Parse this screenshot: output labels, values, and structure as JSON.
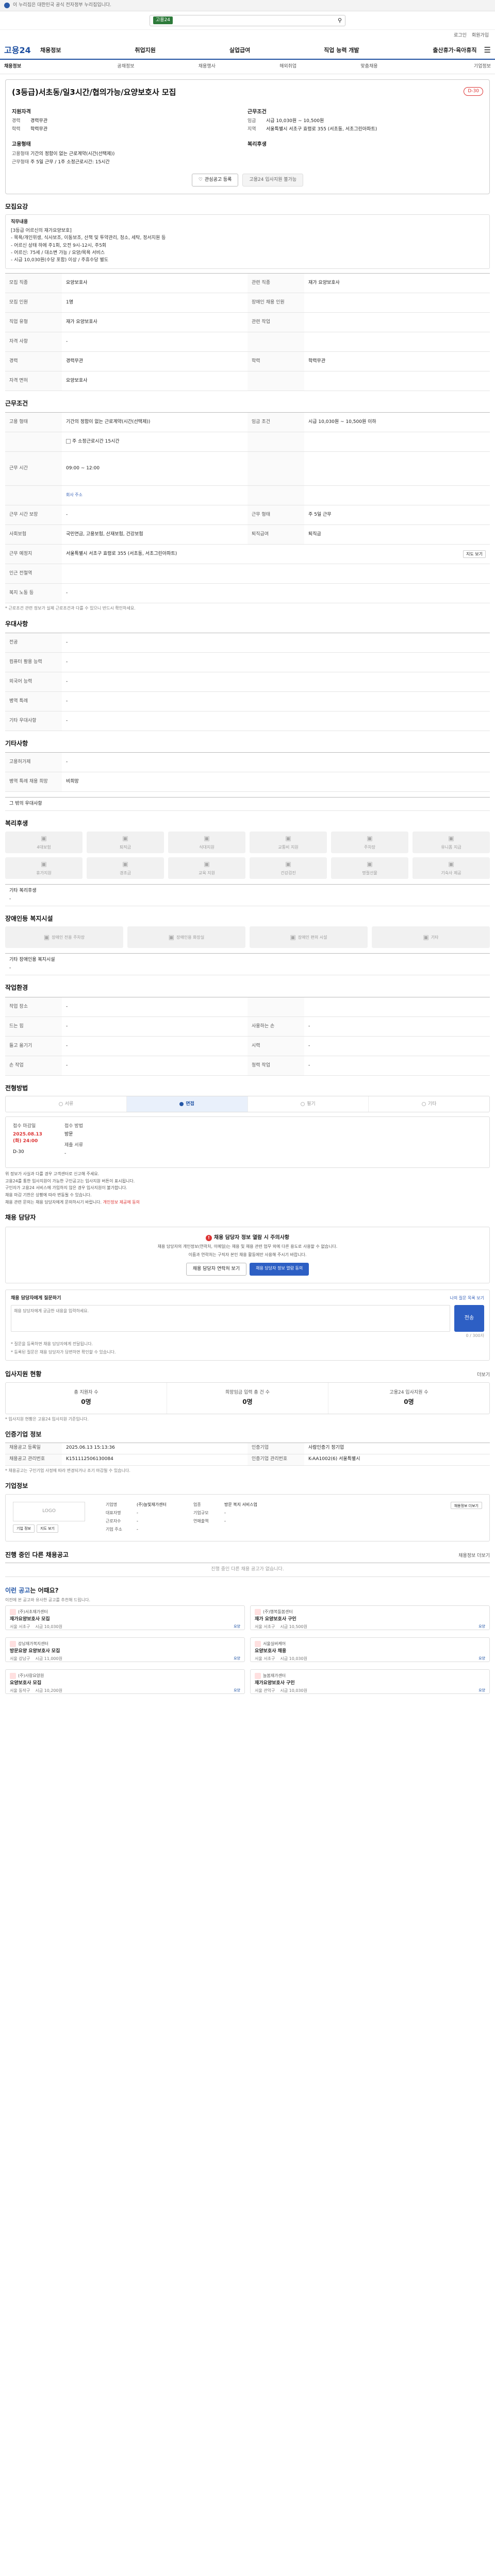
{
  "top_banner": "이 누리집은 대한민국 공식 전자정부 누리집입니다.",
  "search": {
    "tag": "고용24",
    "placeholder": ""
  },
  "util": [
    "로그인",
    "회원가입"
  ],
  "gnb": {
    "logo": "고용24",
    "items": [
      "채용정보",
      "취업지원",
      "실업급여",
      "직업 능력 개발",
      "출산휴가·육아휴직"
    ]
  },
  "subnav": [
    "채용정보",
    "공채정보",
    "채용행사",
    "해외취업",
    "맞춤채용",
    "기업정보"
  ],
  "job": {
    "title": "(3등급)서초동/일3시간/협의가능/요양보호사 모집",
    "dday": "D-30",
    "company_heading": "지원자격",
    "company_rows": [
      {
        "k": "경력",
        "v": "경력무관"
      },
      {
        "k": "학력",
        "v": "학력무관"
      }
    ],
    "cond_heading": "근무조건",
    "cond_rows": [
      {
        "k": "임금",
        "v": "시급 10,030원 ~ 10,500원"
      },
      {
        "k": "지역",
        "v": "서울특별시 서초구 효령로 355 (서초동, 서초그린아파트)"
      }
    ],
    "type_heading": "고용형태",
    "type_rows": [
      {
        "k": "고용형태",
        "v": "기간의 정함이 없는 근로계약(시간(선택제))"
      },
      {
        "k": "근무형태",
        "v": "주 5일 근무 / 1주 소정근로시간: 15시간"
      }
    ],
    "welfare_heading": "복리후생",
    "btn_interest": "관심공고 등록",
    "btn_apply": "고용24 입사지원 불가능"
  },
  "detail": {
    "title": "모집요강",
    "desc_label": "직무내용",
    "desc_lines": [
      "[3등급 어르신의 재가요양보호]",
      "- 목욕/개인위생, 식사보조, 이동보조, 산책 및 투약관리, 청소, 세탁, 정서지원 등",
      "- 어르신 상태 하에 주1회, 오전 9시-12시, 주5회",
      "- 어르신: 75세 / 대소변 가능 / 요양/목욕 서비스",
      "- 시급 10,030원(수당 포함) 이상 / 주휴수당 별도"
    ],
    "rows": [
      {
        "k": "모집 직종",
        "v": "요양보호사",
        "k2": "관련 직종",
        "v2": "재가 요양보호사"
      },
      {
        "k": "모집 인원",
        "v": "1명",
        "k2": "장애인 채용 인원",
        "v2": ""
      },
      {
        "k": "직업 유형",
        "v": "재가 요양보호사",
        "k2": "관련 작업",
        "v2": ""
      },
      {
        "k": "자격 사항",
        "v": "-",
        "k2": "",
        "v2": ""
      },
      {
        "k": "경력",
        "v": "경력무관",
        "k2": "학력",
        "v2": "학력무관"
      },
      {
        "k": "자격 면허",
        "v": "요양보호사",
        "k2": "",
        "v2": ""
      }
    ]
  },
  "condition": {
    "title": "근무조건",
    "rows": [
      {
        "k": "고용 형태",
        "v": "기간의 정함이 없는 근로계약(시간(선택제))",
        "k2": "임금 조건",
        "v2": "시급 10,030원 ~ 10,500원 이하"
      },
      {
        "k": "",
        "v": "주 소정근로시간: 15시간",
        "k2": "",
        "v2": ""
      },
      {
        "k": "근무 시간",
        "v": "09:00 ~ 12:00",
        "k2": "",
        "v2": ""
      },
      {
        "k": "",
        "v": "회사 주소",
        "k2": "",
        "v2": ""
      },
      {
        "k": "근무 시간 보장",
        "v": "-",
        "k2": "근무 형태",
        "v2": "주 5일 근무"
      },
      {
        "k": "사회보험",
        "v": "국민연금, 고용보험, 산재보험, 건강보험",
        "k2": "퇴직급여",
        "v2": "퇴직금"
      },
      {
        "k": "근무 예정지",
        "v": "서울특별시 서초구 효령로 355 (서초동, 서초그린아파트)",
        "k2": "",
        "v2": "지도 보기"
      },
      {
        "k": "인근 전철역",
        "v": "",
        "k2": "",
        "v2": ""
      },
      {
        "k": "복지 노동 등",
        "v": "-",
        "k2": "",
        "v2": ""
      }
    ],
    "time_label": "주 소정근로시간 15시간",
    "notice": "* 근로조건 관련 정보가 실제 근로조건과 다를 수 있으니 반드시 확인하세요."
  },
  "preference": {
    "title": "우대사항",
    "rows": [
      {
        "k": "전공",
        "v": "-"
      },
      {
        "k": "컴퓨터 활용 능력",
        "v": "-"
      },
      {
        "k": "외국어 능력",
        "v": "-"
      },
      {
        "k": "병역 특례",
        "v": "-"
      },
      {
        "k": "기타 우대사항",
        "v": "-"
      }
    ]
  },
  "other": {
    "title": "기타사항",
    "rows": [
      {
        "k": "고용허가제",
        "v": "-"
      },
      {
        "k": "병역 특례 채용 희망",
        "v": "비희망"
      }
    ],
    "link_label": "그 밖의 우대사항"
  },
  "welfare": {
    "title": "복리후생",
    "items": [
      "4대보험",
      "퇴직금",
      "식대지원",
      "교통비 지원",
      "주차장",
      "유니폼 지급",
      "휴가지원",
      "경조금",
      "교육 지원",
      "건강검진",
      "명절선물",
      "기숙사 제공"
    ],
    "etc_label": "기타 복리후생",
    "etc_value": "-"
  },
  "disability": {
    "title": "장애인등 복지시설",
    "items": [
      "장애인 전용 주차장",
      "장애인용 화장실",
      "장애인 편의 시설",
      "기타"
    ],
    "etc_label": "기타 장애인용 복지시설",
    "etc_value": "-"
  },
  "work_env": {
    "title": "작업환경",
    "rows": [
      {
        "k": "작업 장소",
        "v": "-",
        "k2": "",
        "v2": ""
      },
      {
        "k": "드는 힘",
        "v": "-",
        "k2": "사용하는 손",
        "v2": "-"
      },
      {
        "k": "들고 옮기기",
        "v": "-",
        "k2": "시력",
        "v2": "-"
      },
      {
        "k": "손 작업",
        "v": "-",
        "k2": "청력 작업",
        "v2": "-"
      }
    ]
  },
  "process": {
    "title": "전형방법",
    "steps": [
      "서류",
      "면접",
      "필기",
      "기타"
    ],
    "active": 1,
    "col1": {
      "l1": "접수 마감일",
      "v1": "2025.08.13 (화) 24:00",
      "l2": "D-30"
    },
    "col2": {
      "l1": "접수 방법",
      "v1": "방문",
      "l2": "제출 서류",
      "v2": "-"
    },
    "bullets": [
      "위 정보가 사실과 다를 경우 고객센터로 신고해 주세요.",
      "고용24를 통한 입사지원이 가능한 구인공고는 입사지원 버튼이 표시됩니다.",
      "구인자가 고용24 서비스에 가입하지 않은 경우 입사지원이 불가합니다.",
      "채용 마감 기한은 상황에 따라 변동될 수 있습니다.",
      "채용 관련 문의는 채용 담당자에게 문의하시기 바랍니다."
    ],
    "highlight": "개인정보 제공에 동의"
  },
  "contact": {
    "title": "채용 담당자",
    "warn": "채용 담당자 정보 열람 시 주의사항",
    "text1": "채용 담당자의 개인정보(연락처, 이메일)는 채용 및 채용 관련 업무 외에 다른 용도로 사용할 수 없습니다.",
    "text2": "이름과 연락처는 구직자 본인 채용 활동에만 사용해 주시기 바랍니다.",
    "btn1": "채용 담당자 연락처 보기",
    "btn2": "채용 담당자 정보 열람 동의",
    "inquiry_title": "채용 담당자에게 질문하기",
    "inquiry_right": "나의 질문 목록 보기",
    "inquiry_placeholder": "채용 담당자에게 궁금한 내용을 입력하세요.",
    "inquiry_submit": "전송",
    "inquiry_count": "0 / 300자",
    "notes": [
      "* 질문을 등록하면 채용 담당자에게 전달됩니다.",
      "* 등록된 질문은 채용 담당자가 답변하면 확인할 수 있습니다."
    ]
  },
  "status": {
    "title": "입사지원 현황",
    "more": "더보기",
    "items": [
      {
        "l": "총 지원자 수",
        "n": "0명"
      },
      {
        "l": "희망임금 입력 총 건 수",
        "n": "0명"
      },
      {
        "l": "고용24 입사지원 수",
        "n": "0명"
      }
    ],
    "notice": "* 입사지원 현황은 고용24 입사지원 기준입니다."
  },
  "post_info": {
    "title": "인증기업 정보",
    "rows": [
      {
        "k": "채용공고 등록일",
        "v": "2025.06.13 15:13:36",
        "k2": "인증기업",
        "v2": "사람인증기 정기업"
      },
      {
        "k": "채용공고 관리번호",
        "v": "K151112506130084",
        "k2": "인증기업 관리번호",
        "v2": "K-AA1002(6) 서울특별시"
      }
    ],
    "notice": "* 채용공고는 구인기업 사정에 따라 변경되거나 조기 마감될 수 있습니다."
  },
  "company": {
    "title": "기업정보",
    "logo": "LOGO",
    "btns": [
      "기업 정보",
      "지도 보기"
    ],
    "info": [
      {
        "k": "기업명",
        "v": "(주)늘빛재가센터"
      },
      {
        "k": "업종",
        "v": "방문 복지 서비스업"
      },
      {
        "k": "대표자명",
        "v": "-"
      },
      {
        "k": "기업규모",
        "v": "-"
      },
      {
        "k": "근로자수",
        "v": "-"
      },
      {
        "k": "연매출액",
        "v": "-"
      },
      {
        "k": "기업 주소",
        "v": "-"
      }
    ],
    "right_btn": "채용정보 더보기"
  },
  "other_jobs": {
    "title": "진행 중인 다른 채용공고",
    "right": "채용정보 더보기",
    "empty": "진행 중인 다른 채용 공고가 없습니다."
  },
  "recommend": {
    "title_prefix": "이런 공고",
    "title_suffix": "는 어때요?",
    "sub": "이전에 본 공고와 유사한 공고를 추천해 드립니다.",
    "cards": [
      {
        "company": "(주)서초재가센터",
        "job": "재가요양보호사 모집",
        "meta1": "서울 서초구",
        "meta2": "시급 10,030원",
        "tag": "요양"
      },
      {
        "company": "(주)행복돌봄센터",
        "job": "재가 요양보호사 구인",
        "meta1": "서울 서초구",
        "meta2": "시급 10,500원",
        "tag": "요양"
      },
      {
        "company": "강남재가복지센터",
        "job": "방문요양 요양보호사 모집",
        "meta1": "서울 강남구",
        "meta2": "시급 11,000원",
        "tag": "요양"
      },
      {
        "company": "서울실버케어",
        "job": "요양보호사 채용",
        "meta1": "서울 서초구",
        "meta2": "시급 10,030원",
        "tag": "요양"
      },
      {
        "company": "(주)사랑요양원",
        "job": "요양보호사 모집",
        "meta1": "서울 동작구",
        "meta2": "시급 10,200원",
        "tag": "요양"
      },
      {
        "company": "늘봄재가센터",
        "job": "재가요양보호사 구인",
        "meta1": "서울 관악구",
        "meta2": "시급 10,030원",
        "tag": "요양"
      }
    ]
  }
}
